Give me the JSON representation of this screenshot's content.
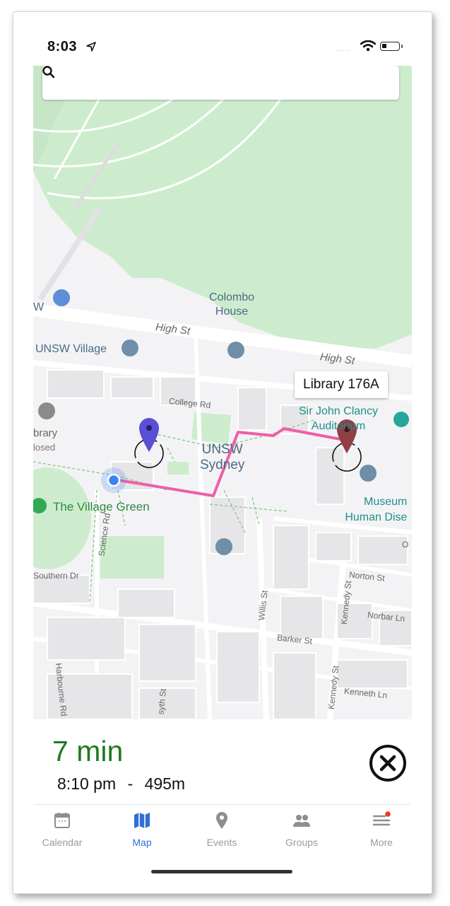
{
  "status_bar": {
    "time": "8:03",
    "signal": "....."
  },
  "search": {
    "placeholder": ""
  },
  "map": {
    "labels": {
      "colombo_line1": "Colombo",
      "colombo_line2": "House",
      "high_st_1": "High St",
      "high_st_2": "High St",
      "unsw_village": "UNSW Village",
      "w_partial": "W",
      "college_rd": "College Rd",
      "library_partial": "brary",
      "closed_partial": "losed",
      "unsw_line1": "UNSW",
      "unsw_line2": "Sydney",
      "clancy_line1": "Sir John Clancy",
      "clancy_line2": "Auditorium",
      "village_green": "The Village Green",
      "museum_line1": "Museum",
      "museum_line2": "Human Dise",
      "science_rd": "Science Rd",
      "southern_dr": "Southern Dr",
      "norton_st": "Norton St",
      "norbar_ln": "Norbar Ln",
      "barker_st": "Barker St",
      "willis_st": "Willis St",
      "kennedy_st_1": "Kennedy St",
      "kennedy_st_2": "Kennedy St",
      "kenneth_ln": "Kenneth Ln",
      "harbourne_rd": "Harbourne Rd",
      "forsyth_partial": "syth St",
      "o_partial": "O"
    },
    "callout": "Library 176A",
    "colors": {
      "route": "#ee5fa8",
      "start_pin": "#5b4fd6",
      "dest_pin": "#8f3f46",
      "current_location": "#3b82f6",
      "park": "#cdeccd"
    }
  },
  "trip": {
    "duration": "7 min",
    "arrival": "8:10 pm",
    "separator": "-",
    "distance": "495m"
  },
  "tabs": [
    {
      "label": "Calendar",
      "icon": "calendar-icon",
      "active": false
    },
    {
      "label": "Map",
      "icon": "map-icon",
      "active": true
    },
    {
      "label": "Events",
      "icon": "location-pin-icon",
      "active": false
    },
    {
      "label": "Groups",
      "icon": "people-icon",
      "active": false
    },
    {
      "label": "More",
      "icon": "menu-icon",
      "active": false,
      "badge": true
    }
  ],
  "accent": "#2f6fd6"
}
